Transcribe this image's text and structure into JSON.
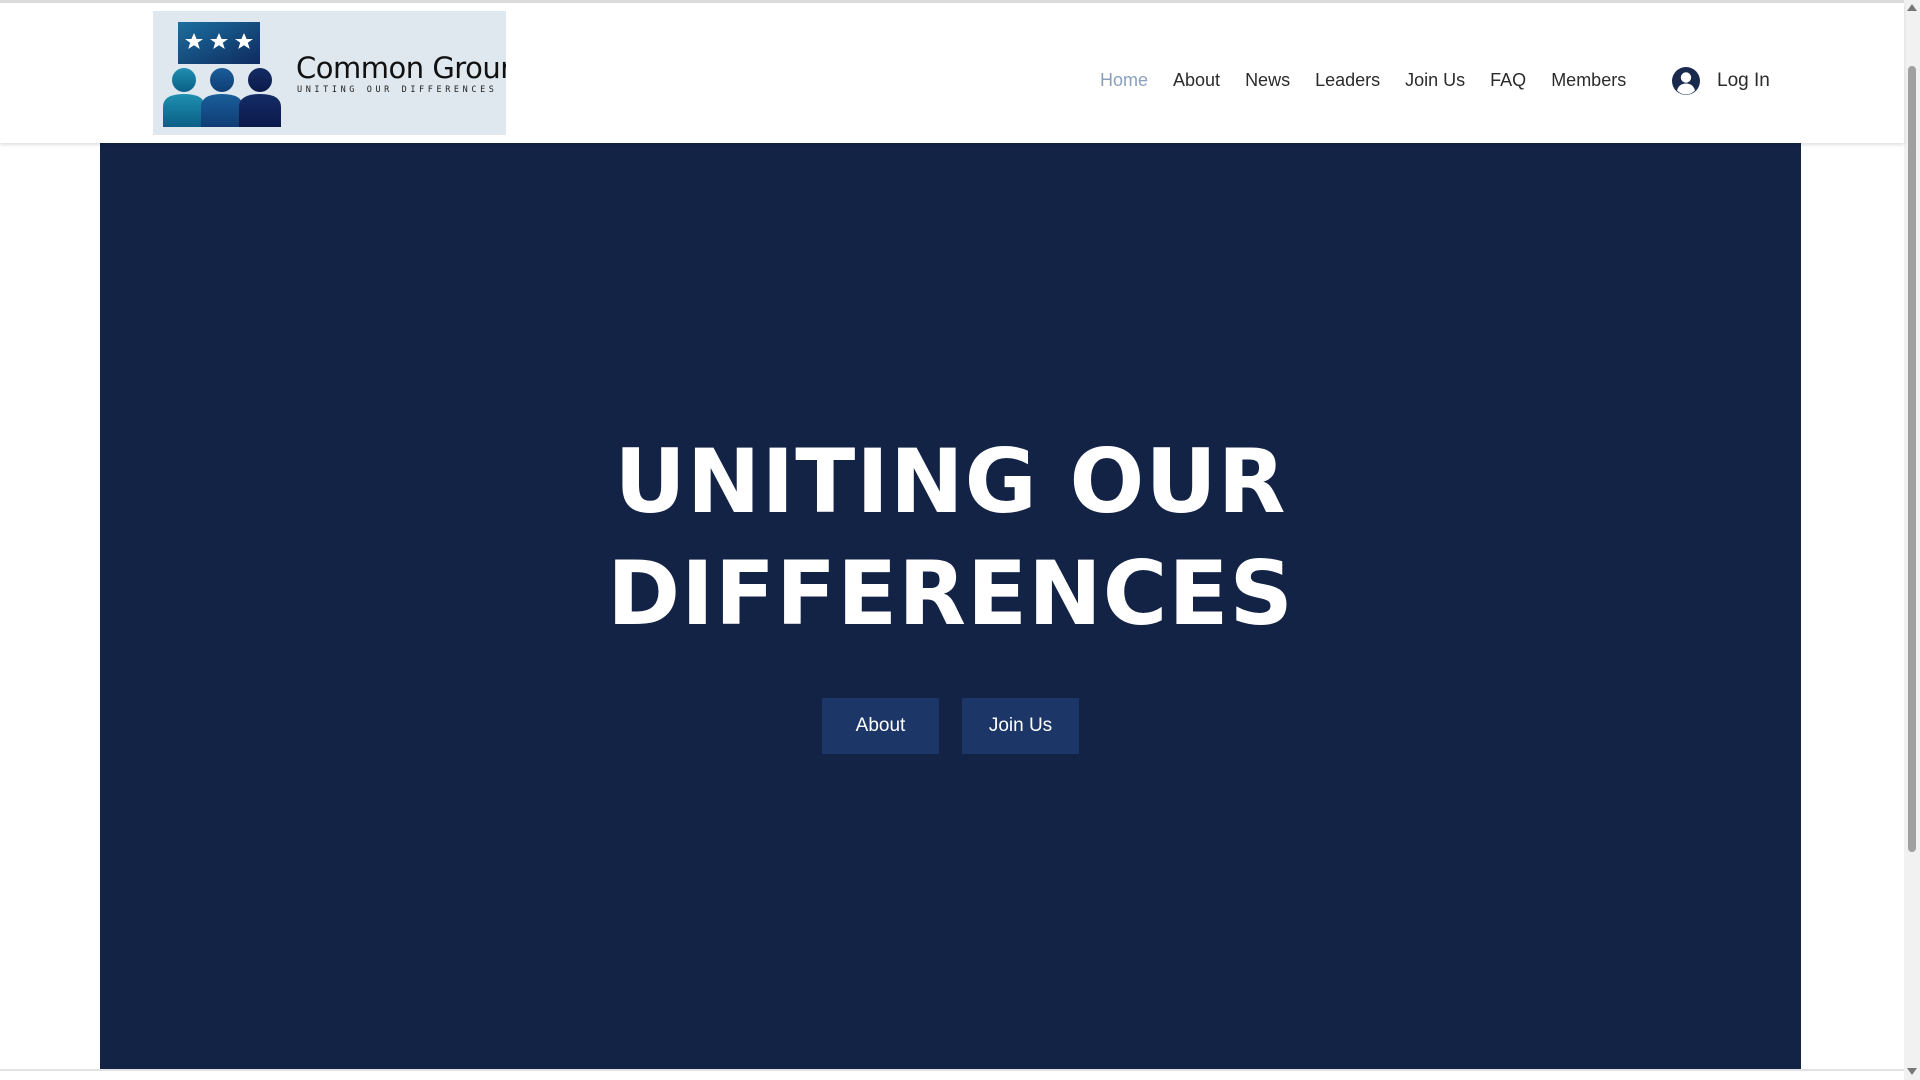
{
  "header": {
    "logo": {
      "title": "Common Ground",
      "tagline": "UNITING OUR DIFFERENCES"
    },
    "nav": [
      {
        "label": "Home",
        "active": true
      },
      {
        "label": "About",
        "active": false
      },
      {
        "label": "News",
        "active": false
      },
      {
        "label": "Leaders",
        "active": false
      },
      {
        "label": "Join Us",
        "active": false
      },
      {
        "label": "FAQ",
        "active": false
      },
      {
        "label": "Members",
        "active": false
      }
    ],
    "login_label": "Log In"
  },
  "hero": {
    "title_line1": "UNITING OUR",
    "title_line2": "DIFFERENCES",
    "buttons": [
      {
        "label": "About"
      },
      {
        "label": "Join Us"
      }
    ]
  },
  "colors": {
    "hero_background": "#132346",
    "hero_button": "#1c3668",
    "nav_active": "#8aa0bd",
    "nav_text": "#2b2b2b",
    "logo_background": "#dfe8ee"
  },
  "icons": {
    "login": "user-avatar-icon",
    "logo_stars": "star-icon",
    "logo_people": "people-icon"
  }
}
